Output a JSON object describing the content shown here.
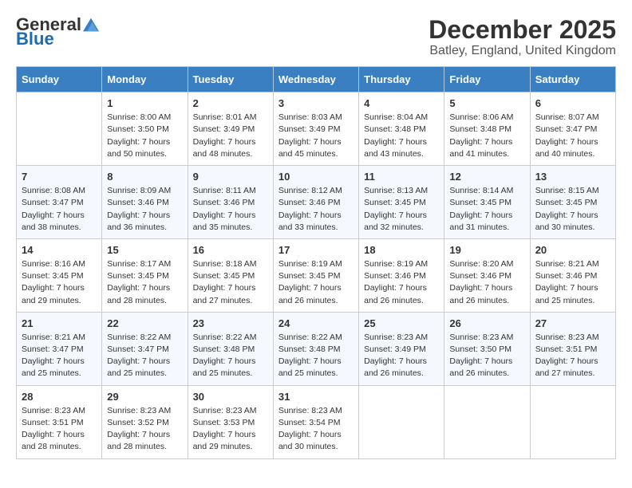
{
  "header": {
    "logo_general": "General",
    "logo_blue": "Blue",
    "month_title": "December 2025",
    "location": "Batley, England, United Kingdom"
  },
  "days_of_week": [
    "Sunday",
    "Monday",
    "Tuesday",
    "Wednesday",
    "Thursday",
    "Friday",
    "Saturday"
  ],
  "weeks": [
    [
      {
        "day": "",
        "info": ""
      },
      {
        "day": "1",
        "info": "Sunrise: 8:00 AM\nSunset: 3:50 PM\nDaylight: 7 hours\nand 50 minutes."
      },
      {
        "day": "2",
        "info": "Sunrise: 8:01 AM\nSunset: 3:49 PM\nDaylight: 7 hours\nand 48 minutes."
      },
      {
        "day": "3",
        "info": "Sunrise: 8:03 AM\nSunset: 3:49 PM\nDaylight: 7 hours\nand 45 minutes."
      },
      {
        "day": "4",
        "info": "Sunrise: 8:04 AM\nSunset: 3:48 PM\nDaylight: 7 hours\nand 43 minutes."
      },
      {
        "day": "5",
        "info": "Sunrise: 8:06 AM\nSunset: 3:48 PM\nDaylight: 7 hours\nand 41 minutes."
      },
      {
        "day": "6",
        "info": "Sunrise: 8:07 AM\nSunset: 3:47 PM\nDaylight: 7 hours\nand 40 minutes."
      }
    ],
    [
      {
        "day": "7",
        "info": "Sunrise: 8:08 AM\nSunset: 3:47 PM\nDaylight: 7 hours\nand 38 minutes."
      },
      {
        "day": "8",
        "info": "Sunrise: 8:09 AM\nSunset: 3:46 PM\nDaylight: 7 hours\nand 36 minutes."
      },
      {
        "day": "9",
        "info": "Sunrise: 8:11 AM\nSunset: 3:46 PM\nDaylight: 7 hours\nand 35 minutes."
      },
      {
        "day": "10",
        "info": "Sunrise: 8:12 AM\nSunset: 3:46 PM\nDaylight: 7 hours\nand 33 minutes."
      },
      {
        "day": "11",
        "info": "Sunrise: 8:13 AM\nSunset: 3:45 PM\nDaylight: 7 hours\nand 32 minutes."
      },
      {
        "day": "12",
        "info": "Sunrise: 8:14 AM\nSunset: 3:45 PM\nDaylight: 7 hours\nand 31 minutes."
      },
      {
        "day": "13",
        "info": "Sunrise: 8:15 AM\nSunset: 3:45 PM\nDaylight: 7 hours\nand 30 minutes."
      }
    ],
    [
      {
        "day": "14",
        "info": "Sunrise: 8:16 AM\nSunset: 3:45 PM\nDaylight: 7 hours\nand 29 minutes."
      },
      {
        "day": "15",
        "info": "Sunrise: 8:17 AM\nSunset: 3:45 PM\nDaylight: 7 hours\nand 28 minutes."
      },
      {
        "day": "16",
        "info": "Sunrise: 8:18 AM\nSunset: 3:45 PM\nDaylight: 7 hours\nand 27 minutes."
      },
      {
        "day": "17",
        "info": "Sunrise: 8:19 AM\nSunset: 3:45 PM\nDaylight: 7 hours\nand 26 minutes."
      },
      {
        "day": "18",
        "info": "Sunrise: 8:19 AM\nSunset: 3:46 PM\nDaylight: 7 hours\nand 26 minutes."
      },
      {
        "day": "19",
        "info": "Sunrise: 8:20 AM\nSunset: 3:46 PM\nDaylight: 7 hours\nand 26 minutes."
      },
      {
        "day": "20",
        "info": "Sunrise: 8:21 AM\nSunset: 3:46 PM\nDaylight: 7 hours\nand 25 minutes."
      }
    ],
    [
      {
        "day": "21",
        "info": "Sunrise: 8:21 AM\nSunset: 3:47 PM\nDaylight: 7 hours\nand 25 minutes."
      },
      {
        "day": "22",
        "info": "Sunrise: 8:22 AM\nSunset: 3:47 PM\nDaylight: 7 hours\nand 25 minutes."
      },
      {
        "day": "23",
        "info": "Sunrise: 8:22 AM\nSunset: 3:48 PM\nDaylight: 7 hours\nand 25 minutes."
      },
      {
        "day": "24",
        "info": "Sunrise: 8:22 AM\nSunset: 3:48 PM\nDaylight: 7 hours\nand 25 minutes."
      },
      {
        "day": "25",
        "info": "Sunrise: 8:23 AM\nSunset: 3:49 PM\nDaylight: 7 hours\nand 26 minutes."
      },
      {
        "day": "26",
        "info": "Sunrise: 8:23 AM\nSunset: 3:50 PM\nDaylight: 7 hours\nand 26 minutes."
      },
      {
        "day": "27",
        "info": "Sunrise: 8:23 AM\nSunset: 3:51 PM\nDaylight: 7 hours\nand 27 minutes."
      }
    ],
    [
      {
        "day": "28",
        "info": "Sunrise: 8:23 AM\nSunset: 3:51 PM\nDaylight: 7 hours\nand 28 minutes."
      },
      {
        "day": "29",
        "info": "Sunrise: 8:23 AM\nSunset: 3:52 PM\nDaylight: 7 hours\nand 28 minutes."
      },
      {
        "day": "30",
        "info": "Sunrise: 8:23 AM\nSunset: 3:53 PM\nDaylight: 7 hours\nand 29 minutes."
      },
      {
        "day": "31",
        "info": "Sunrise: 8:23 AM\nSunset: 3:54 PM\nDaylight: 7 hours\nand 30 minutes."
      },
      {
        "day": "",
        "info": ""
      },
      {
        "day": "",
        "info": ""
      },
      {
        "day": "",
        "info": ""
      }
    ]
  ]
}
